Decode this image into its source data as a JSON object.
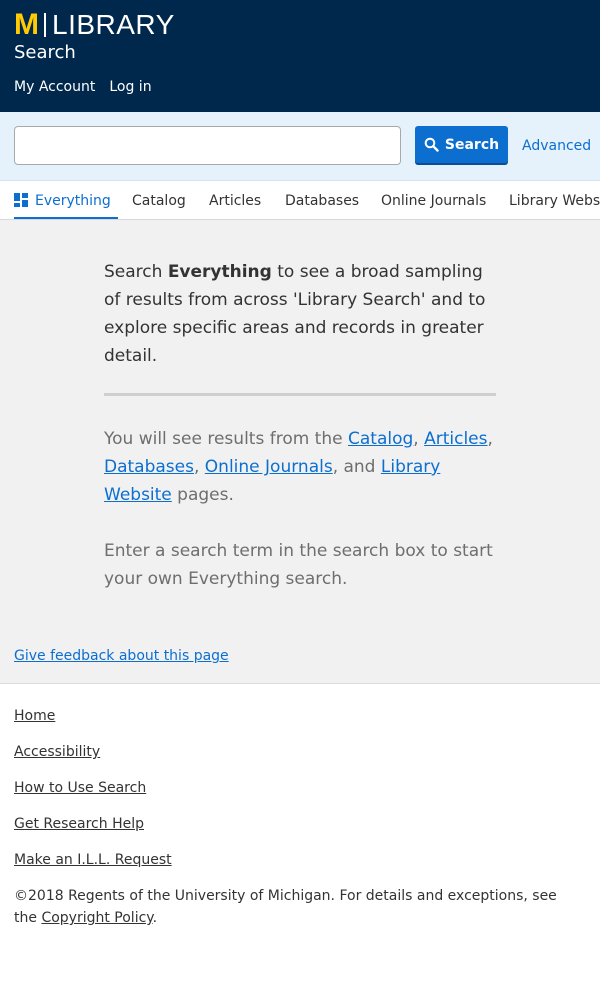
{
  "header": {
    "logo_m": "M",
    "logo_library": "LIBRARY",
    "site_name": "Search",
    "account_nav": [
      "My Account",
      "Log in"
    ],
    "background_color": "#00274c",
    "maize_color": "#ffcb05"
  },
  "search": {
    "value": "",
    "placeholder": "",
    "button_label": "Search",
    "button_icon": "search-icon",
    "advanced_label": "Advanced"
  },
  "tabs": [
    {
      "label": "Everything",
      "active": true,
      "icon": "grid-icon"
    },
    {
      "label": "Catalog",
      "active": false
    },
    {
      "label": "Articles",
      "active": false
    },
    {
      "label": "Databases",
      "active": false
    },
    {
      "label": "Online Journals",
      "active": false
    },
    {
      "label": "Library Website",
      "active": false
    }
  ],
  "main": {
    "intro_before": "Search ",
    "intro_bold": "Everything",
    "intro_after": " to see a broad sampling of results from across 'Library Search' and to explore specific areas and records in greater detail.",
    "results_prefix": "You will see results from the ",
    "results_links": [
      "Catalog",
      "Articles",
      "Databases",
      "Online Journals",
      "Library Website"
    ],
    "results_sep1": ", ",
    "results_sep2": ", ",
    "results_sep3": ", ",
    "results_and": ", and ",
    "results_suffix": " pages.",
    "enter_text": "Enter a search term in the search box to start your own Everything search.",
    "feedback_label": "Give feedback about this page"
  },
  "footer": {
    "links": [
      "Home",
      "Accessibility",
      "How to Use Search",
      "Get Research Help",
      "Make an I.L.L. Request"
    ],
    "copyright_text": "©2018 Regents of the University of Michigan. For details and exceptions, see the ",
    "copyright_link": "Copyright Policy",
    "copyright_end": "."
  },
  "colors": {
    "accent": "#0c6fd0",
    "search_area_bg": "#e5f2fc",
    "main_bg": "#f1f1f1"
  }
}
